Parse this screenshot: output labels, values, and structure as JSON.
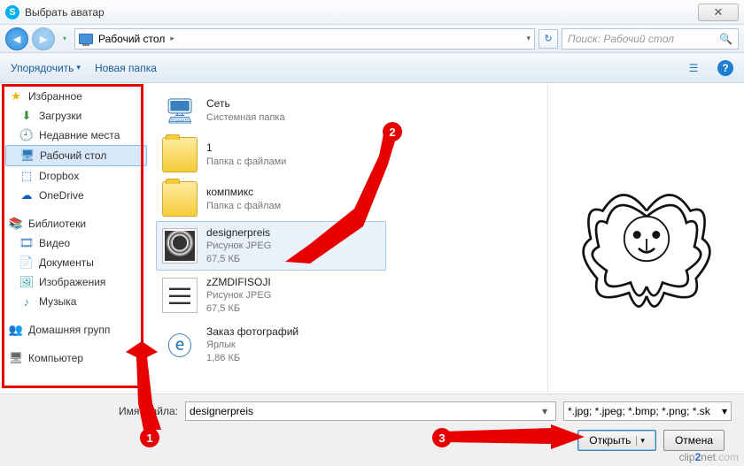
{
  "window": {
    "title": "Выбрать аватар",
    "close_glyph": "✕"
  },
  "nav": {
    "back_glyph": "◄",
    "fwd_glyph": "►",
    "breadcrumb_label": "Рабочий стол",
    "breadcrumb_arrow": "▸",
    "breadcrumb_drop": "▾",
    "refresh_glyph": "↻",
    "search_placeholder": "Поиск: Рабочий стол",
    "search_icon": "🔍"
  },
  "toolbar": {
    "organize": "Упорядочить",
    "organize_drop": "▾",
    "newfolder": "Новая папка",
    "view_icon": "☰",
    "help_icon": "?"
  },
  "sidebar": {
    "favorites": {
      "label": "Избранное",
      "icon": "★",
      "icon_color": "#f2b200"
    },
    "items_fav": [
      {
        "label": "Загрузки",
        "icon": "⬇",
        "color": "#3a8f3a"
      },
      {
        "label": "Недавние места",
        "icon": "🕘",
        "color": "#7a4fa8"
      },
      {
        "label": "Рабочий стол",
        "icon": "🖥",
        "color": "#2a77bb",
        "selected": true
      },
      {
        "label": "Dropbox",
        "icon": "⬚",
        "color": "#0061fe"
      },
      {
        "label": "OneDrive",
        "icon": "☁",
        "color": "#0a5bc4"
      }
    ],
    "libraries": {
      "label": "Библиотеки",
      "icon": "📚",
      "icon_color": "#5a8cc4"
    },
    "items_lib": [
      {
        "label": "Видео",
        "icon": "🎞",
        "color": "#3a7fc0"
      },
      {
        "label": "Документы",
        "icon": "📄",
        "color": "#c99b3a"
      },
      {
        "label": "Изображения",
        "icon": "🖼",
        "color": "#3aa0b0"
      },
      {
        "label": "Музыка",
        "icon": "♪",
        "color": "#3aa0b0"
      }
    ],
    "homegroup": {
      "label": "Домашняя групп",
      "icon": "👥",
      "icon_color": "#3a7fc0"
    },
    "computer": {
      "label": "Компьютер",
      "icon": "🖥",
      "icon_color": "#666"
    }
  },
  "files": [
    {
      "name": "Сеть",
      "sub1": "Системная папка",
      "sub2": "",
      "kind": "network"
    },
    {
      "name": "1",
      "sub1": "Папка с файлами",
      "sub2": "",
      "kind": "folder"
    },
    {
      "name": "компмикс",
      "sub1": "Папка с файлам",
      "sub2": "",
      "kind": "folder"
    },
    {
      "name": "designerpreis",
      "sub1": "Рисунок JPEG",
      "sub2": "67,5 КБ",
      "kind": "img",
      "selected": true
    },
    {
      "name": "zZMDIFISOJI",
      "sub1": "Рисунок JPEG",
      "sub2": "67,5 КБ",
      "kind": "img2"
    },
    {
      "name": "Заказ фотографий",
      "sub1": "Ярлык",
      "sub2": "1,86 КБ",
      "kind": "ielink"
    }
  ],
  "footer": {
    "filename_label": "Имя файла:",
    "filename_value": "designerpreis",
    "filter": "*.jpg; *.jpeg; *.bmp; *.png; *.sk",
    "open": "Открыть",
    "cancel": "Отмена",
    "drop": "▾"
  },
  "annotations": {
    "one": "1",
    "two": "2",
    "three": "3"
  },
  "watermark": {
    "a": "clip",
    "b": "2",
    "c": "net",
    "d": ".com"
  }
}
